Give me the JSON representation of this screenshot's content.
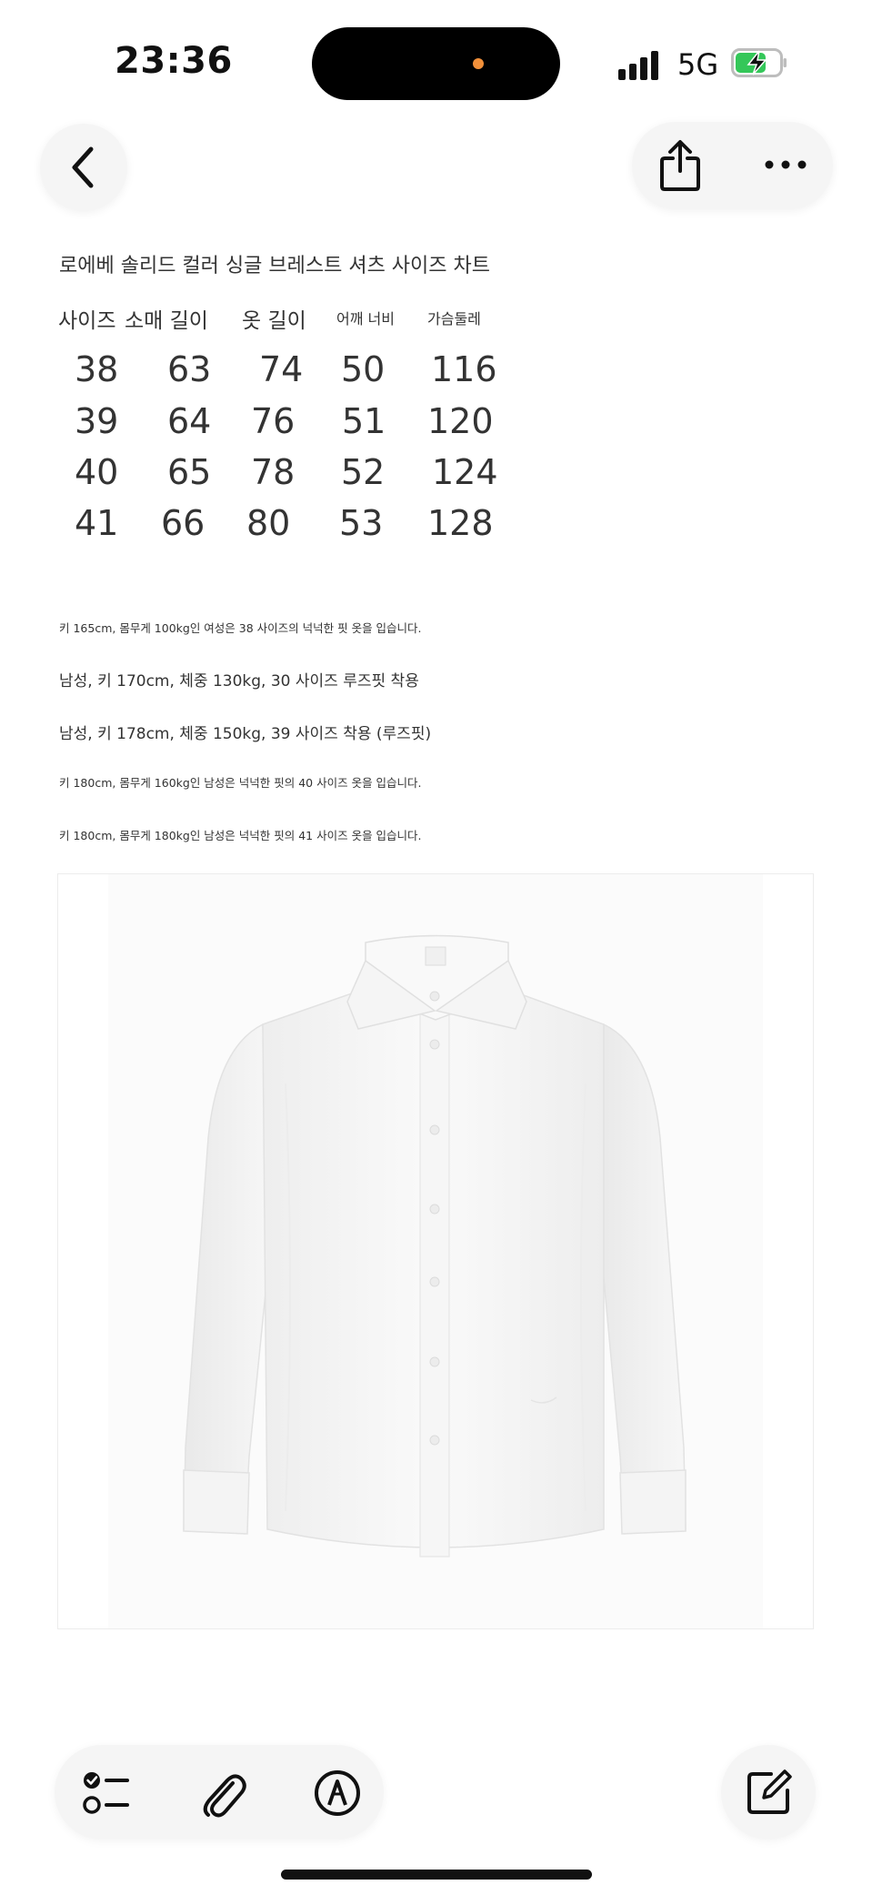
{
  "status_bar": {
    "time": "23:36",
    "network": "5G",
    "colors": {
      "battery_fill": "#34c759",
      "island_dot": "#f2903a"
    }
  },
  "nav": {
    "back_icon": "chevron-left-icon",
    "share_icon": "share-icon",
    "more_icon": "ellipsis-icon"
  },
  "size_chart": {
    "title": "로에베 솔리드 컬러 싱글 브레스트 셔츠 사이즈 차트",
    "headers": [
      "사이즈",
      "소매 길이",
      "옷 길이",
      "어깨 너비",
      "가슴둘레"
    ],
    "rows": [
      [
        "38",
        "63",
        "74",
        "50",
        "116"
      ],
      [
        "39",
        "64",
        "76",
        "51",
        "120"
      ],
      [
        "40",
        "65",
        "78",
        "52",
        "124"
      ],
      [
        "41",
        "66",
        "80",
        "53",
        "128"
      ]
    ]
  },
  "notes": [
    "키 165cm, 몸무게 100kg인 여성은 38 사이즈의 넉넉한 핏 옷을 입습니다.",
    "남성, 키 170cm, 체중 130kg, 30 사이즈 루즈핏 착용",
    "남성, 키 178cm, 체중 150kg, 39 사이즈 착용 (루즈핏)",
    "키 180cm, 몸무게 160kg인 남성은 넉넉한 핏의 40 사이즈 옷을 입습니다.",
    "키 180cm, 몸무게 180kg인 남성은 넉넉한 핏의 41 사이즈 옷을 입습니다."
  ],
  "toolbar": {
    "checklist_icon": "checklist-icon",
    "attachment_icon": "paperclip-icon",
    "markup_icon": "markup-pen-icon",
    "compose_icon": "compose-icon"
  }
}
